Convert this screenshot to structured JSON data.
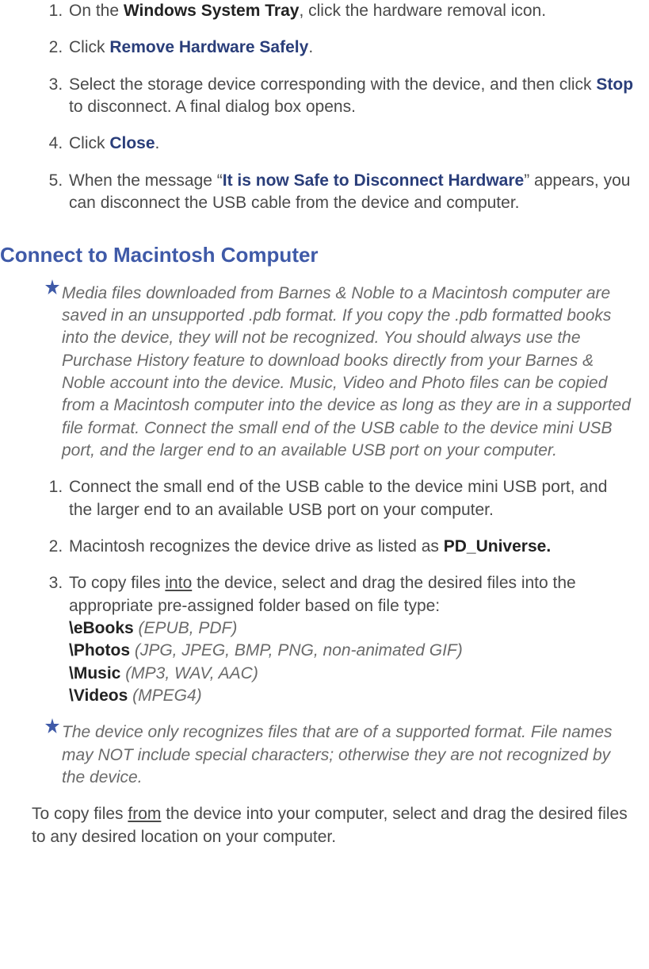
{
  "list1": {
    "item1_pre": "On the ",
    "item1_bold": "Windows System Tray",
    "item1_post": ", click the hardware removal icon.",
    "item2_pre": "Click ",
    "item2_term": "Remove Hardware Safely",
    "item2_post": ".",
    "item3_pre": "Select the storage device corresponding with the device, and then click ",
    "item3_term": "Stop",
    "item3_post": " to disconnect. A final dialog box opens.",
    "item4_pre": "Click ",
    "item4_term": "Close",
    "item4_post": ".",
    "item5_pre": "When the message “",
    "item5_term": "It is now Safe to Disconnect Hardware",
    "item5_post": "” appears, you can disconnect the USB cable from the device and computer."
  },
  "heading": "Connect to Macintosh Computer",
  "note1": "Media files downloaded from Barnes & Noble to a Macintosh computer are saved in an unsupported .pdb format. If you copy the .pdb formatted books into the device, they will not be recognized. You should always use the Purchase History feature to download books directly from your Barnes & Noble account into the device. Music, Video and Photo files can be copied from a Macintosh computer into the device as long as they are in a supported file format. Connect the small end of the USB cable to the device mini USB port, and the larger end to an available USB port on your computer.",
  "list2": {
    "item1": "Connect the small end of the USB cable to the device mini USB port, and the larger end to an available USB port on your computer.",
    "item2_pre": "Macintosh recognizes the device drive as listed as ",
    "item2_bold": "PD_Universe.",
    "item3_pre": "To copy files ",
    "item3_under": "into",
    "item3_post": " the device, select and drag the desired files into the appropriate pre-assigned folder based on file type:",
    "f1_b": "\\eBooks",
    "f1_i": " (EPUB, PDF)",
    "f2_b": "\\Photos",
    "f2_i": " (JPG, JPEG, BMP, PNG, non-animated GIF)",
    "f3_b": "\\Music",
    "f3_i": " (MP3, WAV, AAC)",
    "f4_b": "\\Videos",
    "f4_i": " (MPEG4)"
  },
  "note2": "The device only recognizes files that are of a supported format. File names may NOT include special characters; otherwise they are not recognized by the device.",
  "para_pre": "To copy files ",
  "para_under": "from",
  "para_post": " the device into your computer, select and drag the desired files to any desired location on your computer."
}
